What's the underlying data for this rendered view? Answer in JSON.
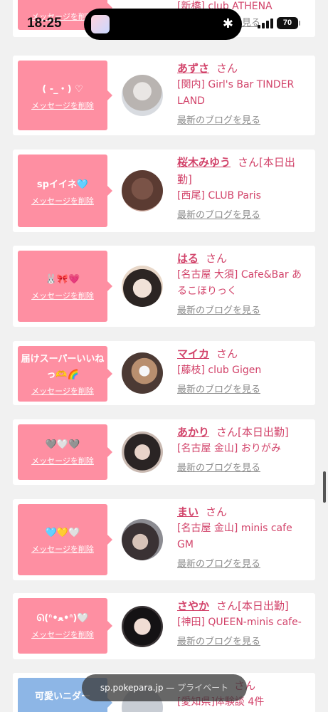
{
  "status_bar": {
    "time": "18:25",
    "battery": "70"
  },
  "top_partial": {
    "shop": "[新橋] club ATHENA",
    "blog": "最新のブログを見る",
    "delete": "メッセージを削除"
  },
  "delete_label": "メッセージを削除",
  "blog_label": "最新のブログを見る",
  "cards": [
    {
      "message": "( -_・) ♡",
      "name": "あずさ",
      "san": "さん",
      "shop": "[関内] Girl's Bar TINDER LAND"
    },
    {
      "message": "spイイネ🩵",
      "name": "桜木みゆう",
      "san": "さん[本日出勤]",
      "shop": "[西尾] CLUB Paris"
    },
    {
      "message": "🐰🎀💗",
      "name": "はる",
      "san": "さん",
      "shop": "[名古屋 大須] Cafe&Bar あるこほりっく"
    },
    {
      "message": "届けスーパーいいねっ🫶🌈",
      "name": "マイカ",
      "san": "さん",
      "shop": "[藤枝] club Gigen"
    },
    {
      "message": "🩶🤍🩶",
      "name": "あかり",
      "san": "さん[本日出勤]",
      "shop": "[名古屋 金山] おりがみ"
    },
    {
      "message": "🩵💛🤍",
      "name": "まい",
      "san": "さん",
      "shop": "[名古屋 金山] minis cafe GM"
    },
    {
      "message": "ᘏ(ᐢ•ﻌ•ᐢ)🤍",
      "name": "さやか",
      "san": "さん[本日出勤]",
      "shop": "[神田] QUEEN-minis cafe-"
    }
  ],
  "bottom_partial": {
    "message": "可愛いニダー",
    "san": "さん",
    "shop": "[愛知県]体験談 4件"
  },
  "url_bar": {
    "domain": "sp.pokepara.jp",
    "separator": " — ",
    "mode": "プライベート"
  }
}
